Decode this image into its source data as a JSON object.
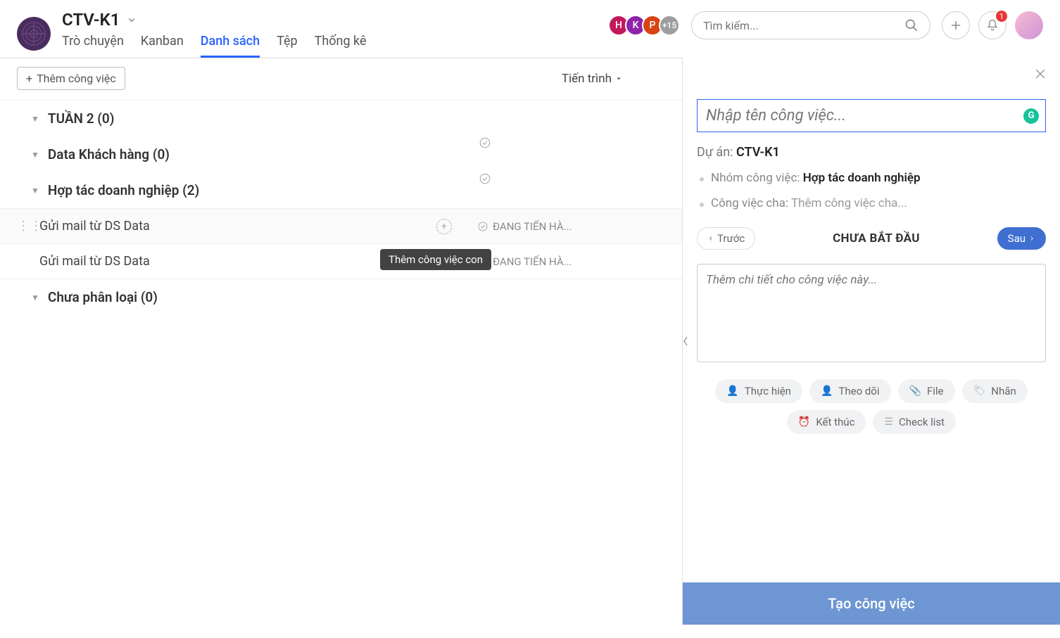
{
  "header": {
    "title": "CTV-K1",
    "tabs": [
      "Trò chuyện",
      "Kanban",
      "Danh sách",
      "Tệp",
      "Thống kê"
    ],
    "active_tab": 2,
    "avatars": [
      {
        "letter": "H",
        "color": "#c2185b"
      },
      {
        "letter": "K",
        "color": "#8e24aa"
      },
      {
        "letter": "P",
        "color": "#d84315"
      }
    ],
    "avatar_more": "+15",
    "search_placeholder": "Tìm kiếm...",
    "notification_count": "1"
  },
  "list": {
    "add_task_label": "Thêm công việc",
    "progress_col": "Tiến trình",
    "groups": [
      {
        "name": "TUẦN 2",
        "count": 0
      },
      {
        "name": "Data Khách hàng",
        "count": 0
      },
      {
        "name": "Hợp tác doanh nghiệp",
        "count": 2
      },
      {
        "name": "Chưa phân loại",
        "count": 0
      }
    ],
    "tasks": [
      {
        "name": "Gửi mail từ DS Data",
        "status": "ĐANG TIẾN HÀ..."
      },
      {
        "name": "Gửi mail từ DS Data",
        "status": "ĐANG TIẾN HÀ..."
      }
    ],
    "tooltip": "Thêm công việc con"
  },
  "panel": {
    "name_placeholder": "Nhập tên công việc...",
    "project_label": "Dự án:",
    "project_value": "CTV-K1",
    "group_label": "Nhóm công việc:",
    "group_value": "Hợp tác doanh nghiệp",
    "parent_label": "Công việc cha:",
    "parent_value": "Thêm công việc cha...",
    "prev": "Trước",
    "status": "CHƯA BẮT ĐẦU",
    "next": "Sau",
    "desc_placeholder": "Thêm chi tiết cho công việc này...",
    "chips": {
      "assignee": "Thực hiện",
      "follower": "Theo dõi",
      "file": "File",
      "label": "Nhãn",
      "deadline": "Kết thúc",
      "checklist": "Check list"
    },
    "create": "Tạo công việc"
  }
}
